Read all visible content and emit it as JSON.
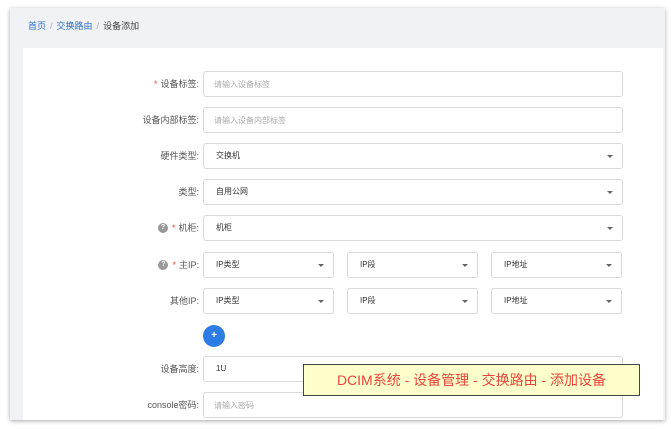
{
  "breadcrumb": {
    "home": "首页",
    "section": "交换路由",
    "current": "设备添加",
    "separator": "/"
  },
  "form": {
    "required_mark": "*",
    "help_glyph": "?",
    "device_tag": {
      "label": "设备标签:",
      "placeholder": "请输入设备标签"
    },
    "internal_tag": {
      "label": "设备内部标签:",
      "placeholder": "请输入设备内部标签"
    },
    "hardware_type": {
      "label": "硬件类型:",
      "value": "交换机"
    },
    "type": {
      "label": "类型:",
      "value": "自用公网"
    },
    "cabinet": {
      "label": "机柜:",
      "value": "机柜"
    },
    "main_ip": {
      "label": "主IP:",
      "ip_type": "IP类型",
      "ip_segment": "IP段",
      "ip_address": "IP地址"
    },
    "other_ip": {
      "label": "其他IP:",
      "ip_type": "IP类型",
      "ip_segment": "IP段",
      "ip_address": "IP地址"
    },
    "add_button": "+",
    "device_height": {
      "label": "设备高度:",
      "value": "1U"
    },
    "console_password": {
      "label": "console密码:",
      "placeholder": "请输入密码"
    }
  },
  "caption": "DCIM系统 - 设备管理 - 交换路由 - 添加设备",
  "colors": {
    "link": "#2c6fc5",
    "accent": "#2d7be5",
    "required": "#e8453c",
    "caption_bg": "#ffffcc"
  }
}
